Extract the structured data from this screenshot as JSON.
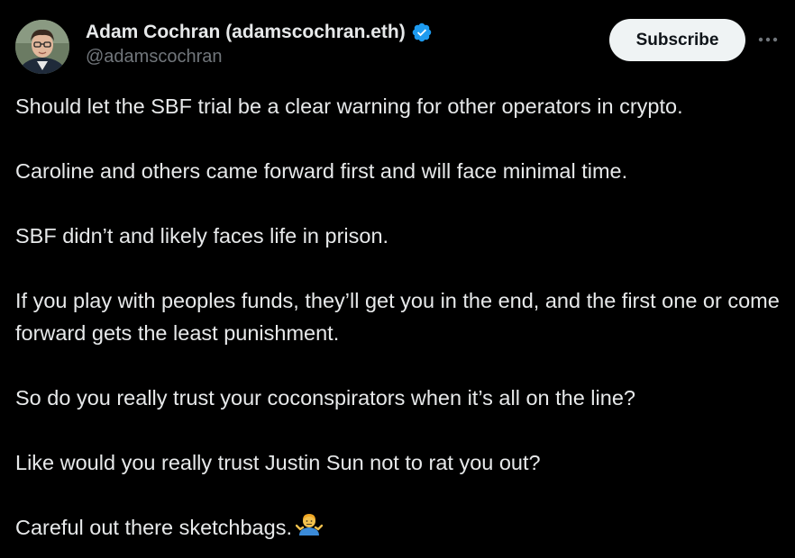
{
  "author": {
    "display_name": "Adam Cochran (adamscochran.eth)",
    "handle": "@adamscochran",
    "verified_icon": "verified-badge-icon",
    "avatar_icon": "avatar"
  },
  "actions": {
    "subscribe_label": "Subscribe",
    "more_icon": "more-options-icon"
  },
  "tweet": {
    "paragraphs": [
      "Should let the SBF trial be a clear warning for other operators in crypto.",
      "Caroline and others came forward first and will face minimal time.",
      "SBF didn’t and likely faces life in prison.",
      "If you play with peoples funds, they’ll get you in the end, and the first one or come forward gets the least punishment.",
      "So do you really trust your coconspirators when it’s all on the line?",
      "Like would you really trust Justin Sun not to rat you out?",
      "Careful out there sketchbags."
    ],
    "trailing_emoji": "man-shrugging-emoji"
  },
  "colors": {
    "background": "#000000",
    "text": "#e7e9ea",
    "secondary_text": "#71767b",
    "verified": "#1d9bf0",
    "button_bg": "#eff3f4",
    "button_text": "#0f1419"
  }
}
